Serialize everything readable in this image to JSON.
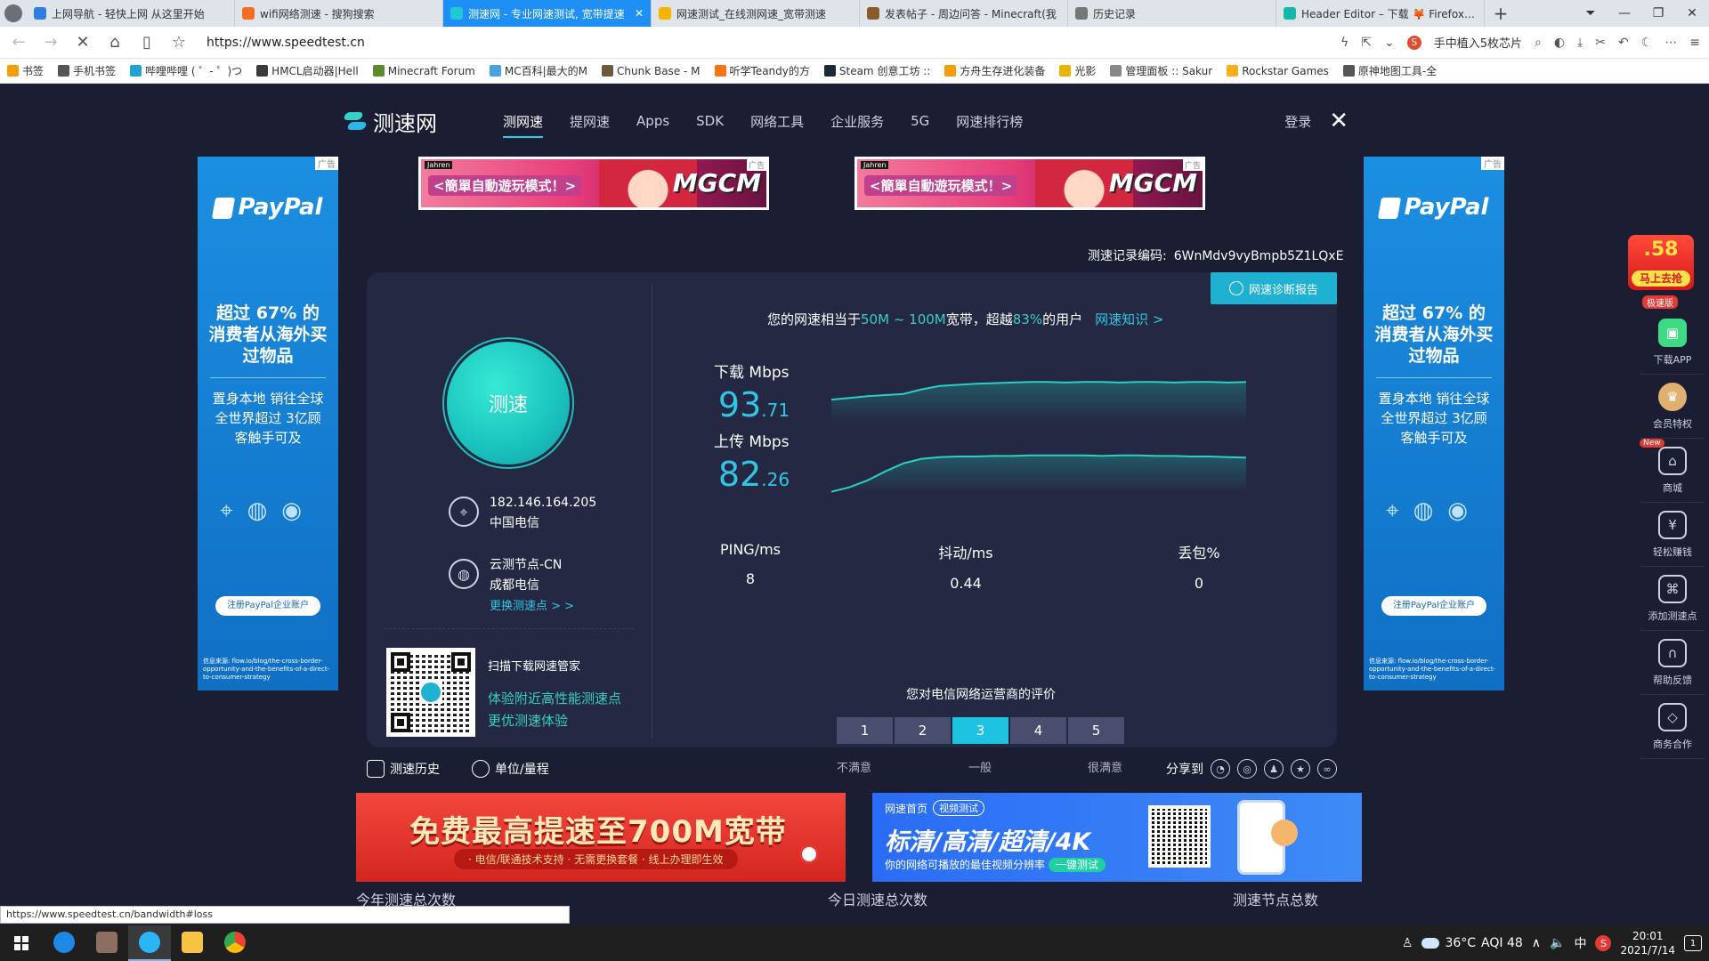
{
  "browser": {
    "tabs": [
      {
        "title": "上网导航 - 轻快上网 从这里开始",
        "color": "#2f7de1",
        "active": false
      },
      {
        "title": "wifi网络测速 - 搜狗搜索",
        "color": "#f46d22",
        "active": false
      },
      {
        "title": "测速网 - 专业网速测试, 宽带提速",
        "color": "#22c7d6",
        "active": true
      },
      {
        "title": "网速测试_在线测网速_宽带测速",
        "color": "#f5b400",
        "active": false
      },
      {
        "title": "发表帖子 - 周边问答 - Minecraft(我",
        "color": "#8a5a2b",
        "active": false
      },
      {
        "title": "历史记录",
        "color": "#777777",
        "active": false
      },
      {
        "title": "Header Editor – 下载 🦊 Firefox 扩",
        "color": "#14b8a6",
        "active": false
      }
    ],
    "new_tab": "+",
    "url": "https://www.speedtest.cn",
    "search_hint": "手中植入5枚芯片",
    "bookmarks": [
      {
        "label": "书签",
        "color": "#f59e0b"
      },
      {
        "label": "手机书签",
        "color": "#555555"
      },
      {
        "label": "哔哩哔哩 ( ゜- ゜)つ",
        "color": "#23a1d6"
      },
      {
        "label": "HMCL启动器|Hell",
        "color": "#3b3b3b"
      },
      {
        "label": "Minecraft Forum",
        "color": "#5b8a2f"
      },
      {
        "label": "MC百科|最大的M",
        "color": "#4aa3df"
      },
      {
        "label": "Chunk Base - M",
        "color": "#6b5b3a"
      },
      {
        "label": "听学Teandy的方",
        "color": "#f97316"
      },
      {
        "label": "Steam 创意工坊 ::",
        "color": "#1b2838"
      },
      {
        "label": "方舟生存进化装备",
        "color": "#f59e0b"
      },
      {
        "label": "光影",
        "color": "#eab308"
      },
      {
        "label": "管理面板 :: Sakur",
        "color": "#888888"
      },
      {
        "label": "Rockstar Games",
        "color": "#fcaf17"
      },
      {
        "label": "原神地图工具-全",
        "color": "#555555"
      }
    ],
    "status_url": "https://www.speedtest.cn/bandwidth#loss"
  },
  "site": {
    "logo": "测速网",
    "nav": [
      "测网速",
      "提网速",
      "Apps",
      "SDK",
      "网络工具",
      "企业服务",
      "5G",
      "网速排行榜"
    ],
    "login": "登录",
    "close": "✕"
  },
  "ads": {
    "tag": "广告",
    "paypal": {
      "brand": "PayPal",
      "headline": "超过 67% 的消费者从海外买过物品",
      "body": "置身本地 销往全球 全世界超过 3亿顾客触手可及",
      "button": "注册PayPal企业账户",
      "source": "信息来源: flow.io/blog/the-cross-border-opportunity-and-the-benefits-of-a-direct-to-consumer-strategy"
    },
    "banner": {
      "brand": "Jahren",
      "text": "<簡單自動遊玩模式！>",
      "game": "MGCM"
    },
    "bottom_left": {
      "headline": "免费最高提速至700M宽带",
      "sub": "· 电信/联通技术支持 · 无需更换套餐 · 线上办理即生效"
    },
    "bottom_right": {
      "brand": "网速首页",
      "pill": "视频测试",
      "headline": "标清/高清/超清/4K",
      "sub": "你的网络可播放的最佳视频分辨率",
      "button": "一键测试"
    }
  },
  "test": {
    "record_label": "测速记录编码:",
    "record_id": "6WnMdv9vyBmpb5Z1LQxE",
    "diag_button": "网速诊断报告",
    "gauge_label": "测速",
    "ip": "182.146.164.205",
    "isp": "中国电信",
    "node_name": "云测节点-CN",
    "node_isp": "成都电信",
    "change_node": "更换测速点 > >",
    "qr_title": "扫描下载网速管家",
    "qr_line1": "体验附近高性能测速点",
    "qr_line2": "更优测速体验",
    "summary_prefix": "您的网速相当于",
    "summary_band": "50M ~ 100M",
    "summary_mid": "宽带，超越",
    "summary_pct": "83%",
    "summary_suffix": "的用户",
    "summary_link": "网速知识 >",
    "download_label": "下载 Mbps",
    "download_int": "93",
    "download_dec": ".71",
    "upload_label": "上传 Mbps",
    "upload_int": "82",
    "upload_dec": ".26",
    "ping_label": "PING/ms",
    "ping": "8",
    "jitter_label": "抖动/ms",
    "jitter": "0.44",
    "loss_label": "丢包%",
    "loss": "0",
    "rating_title": "您对电信网络运营商的评价",
    "rating_options": [
      "1",
      "2",
      "3",
      "4",
      "5"
    ],
    "rating_selected": 3,
    "rating_low": "不满意",
    "rating_mid": "一般",
    "rating_high": "很满意",
    "download_trace": [
      0.42,
      0.45,
      0.48,
      0.5,
      0.52,
      0.6,
      0.66,
      0.68,
      0.7,
      0.71,
      0.72,
      0.73,
      0.73,
      0.72,
      0.73,
      0.73,
      0.72,
      0.73,
      0.73,
      0.72,
      0.73,
      0.73,
      0.72,
      0.73
    ],
    "upload_trace": [
      0.02,
      0.1,
      0.22,
      0.38,
      0.52,
      0.6,
      0.63,
      0.64,
      0.64,
      0.65,
      0.65,
      0.66,
      0.66,
      0.66,
      0.66,
      0.65,
      0.66,
      0.66,
      0.65,
      0.65,
      0.64,
      0.64,
      0.63,
      0.62
    ]
  },
  "tools": {
    "history": "测速历史",
    "unit": "单位/量程",
    "share": "分享到",
    "share_icons": [
      "wechat-icon",
      "weibo-icon",
      "qq-icon",
      "qzone-icon",
      "link-icon"
    ]
  },
  "stats": {
    "year_label": "今年测速总次数",
    "today_label": "今日测速总次数",
    "nodes_label": "测速节点总数"
  },
  "side_tools": {
    "promo_num": ".58",
    "promo_go": "马上去抢",
    "fast": "极速版",
    "items": [
      {
        "label": "下载APP",
        "icon": "android-icon"
      },
      {
        "label": "会员特权",
        "icon": "crown-icon"
      },
      {
        "label": "商城",
        "icon": "shop-icon",
        "new": "New"
      },
      {
        "label": "轻松赚钱",
        "icon": "money-bag-icon"
      },
      {
        "label": "添加测速点",
        "icon": "add-node-icon"
      },
      {
        "label": "帮助反馈",
        "icon": "headset-icon"
      },
      {
        "label": "商务合作",
        "icon": "handshake-icon"
      }
    ]
  },
  "taskbar": {
    "temp": "36°C",
    "aqi": "AQI 48",
    "ime": "中",
    "time": "20:01",
    "date": "2021/7/14",
    "notif": "1"
  }
}
